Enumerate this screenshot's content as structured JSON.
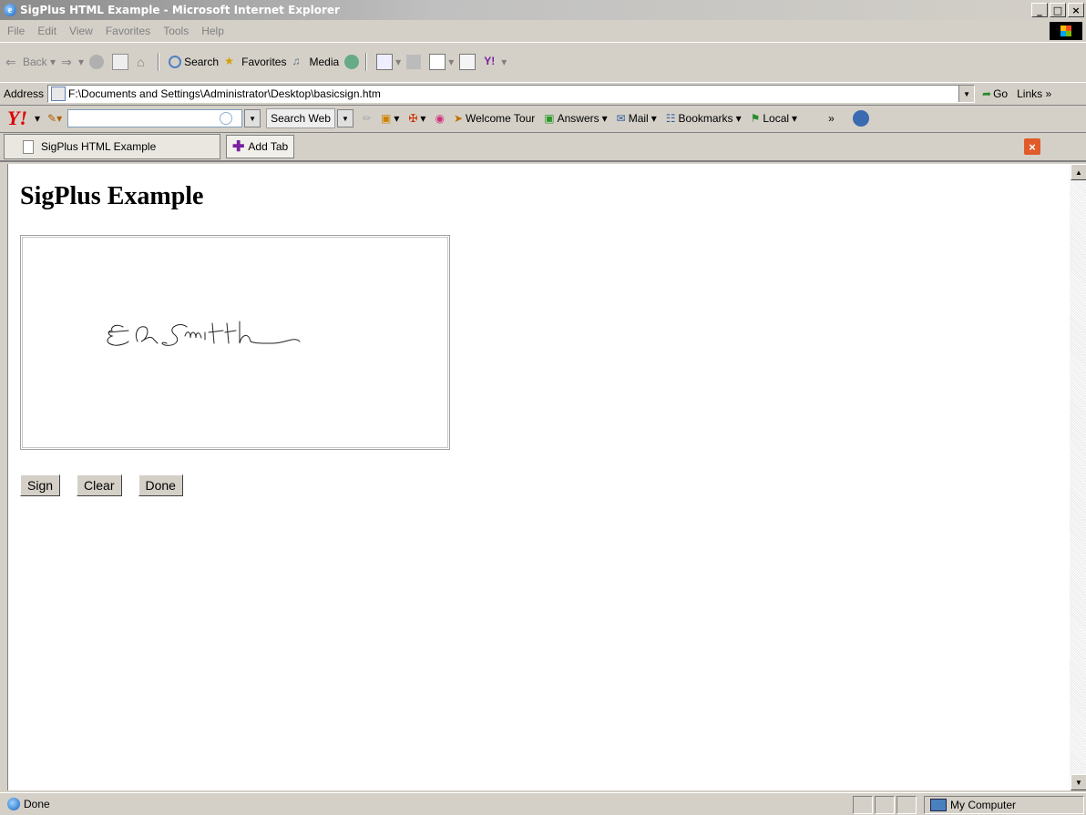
{
  "window": {
    "title": "SigPlus HTML Example - Microsoft Internet Explorer",
    "minimize": "_",
    "maximize": "□",
    "close": "×"
  },
  "menu": [
    "File",
    "Edit",
    "View",
    "Favorites",
    "Tools",
    "Help"
  ],
  "toolbar": {
    "back": "Back",
    "search": "Search",
    "favorites": "Favorites",
    "media": "Media"
  },
  "address": {
    "label": "Address",
    "value": "F:\\Documents and Settings\\Administrator\\Desktop\\basicsign.htm",
    "go": "Go",
    "links": "Links"
  },
  "yahoo_toolbar": {
    "logo": "Y!",
    "search_web": "Search Web",
    "welcome_tour": "Welcome Tour",
    "answers": "Answers",
    "mail": "Mail",
    "bookmarks": "Bookmarks",
    "local": "Local"
  },
  "tabs": {
    "active": "SigPlus HTML Example",
    "add_tab": "Add Tab"
  },
  "page": {
    "heading": "SigPlus Example",
    "signature_text": "E A Smith",
    "buttons": [
      "Sign",
      "Clear",
      "Done"
    ]
  },
  "status": {
    "text": "Done",
    "zone": "My Computer"
  }
}
